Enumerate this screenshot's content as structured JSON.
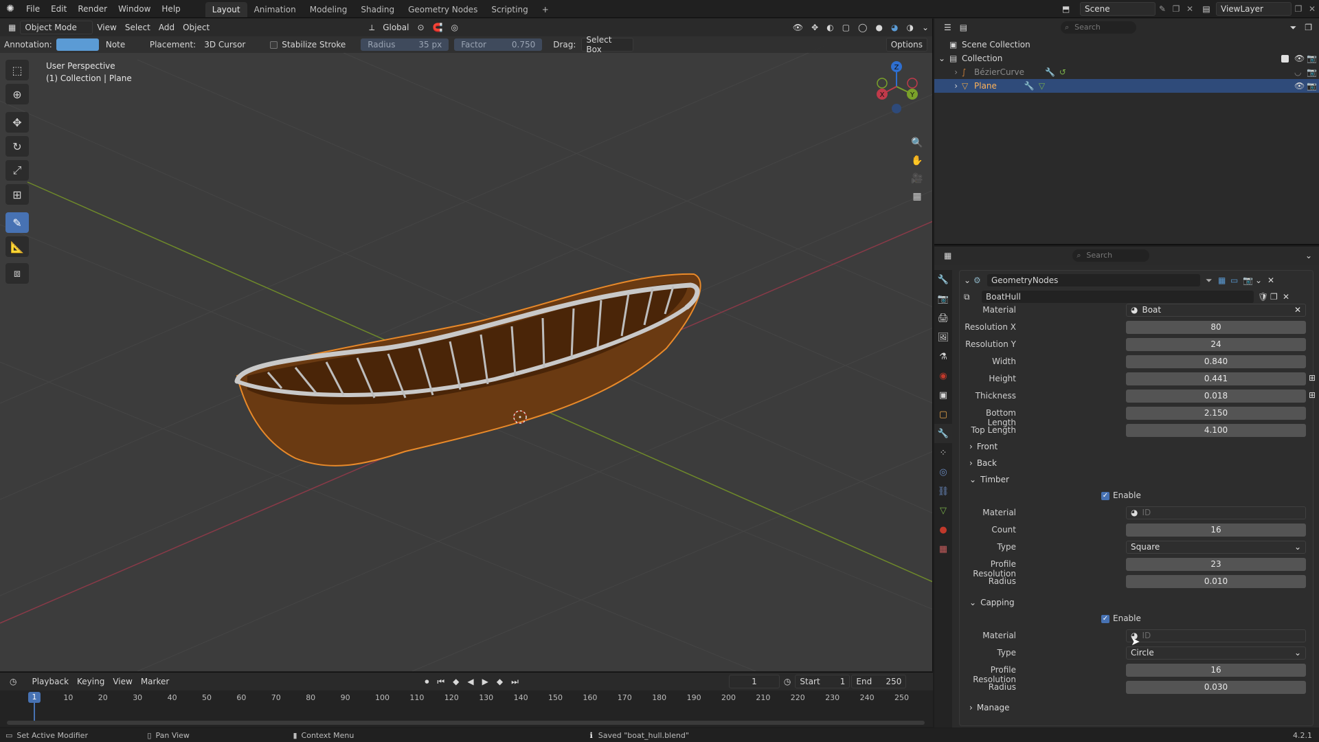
{
  "menu": {
    "items": [
      "File",
      "Edit",
      "Render",
      "Window",
      "Help"
    ]
  },
  "workspaces": {
    "tabs": [
      "Layout",
      "Animation",
      "Modeling",
      "Shading",
      "Geometry Nodes",
      "Scripting"
    ],
    "active": "Layout",
    "add": "+"
  },
  "scene": {
    "name": "Scene",
    "view_layer": "ViewLayer"
  },
  "viewport": {
    "mode": "Object Mode",
    "menus": [
      "View",
      "Select",
      "Add",
      "Object"
    ],
    "orientation": "Global",
    "overlay_text": {
      "perspective": "User Perspective",
      "collection": "(1) Collection | Plane"
    },
    "gizmo_axes": {
      "x": "X",
      "y": "Y",
      "z": "Z"
    }
  },
  "tool_settings": {
    "annotation_label": "Annotation:",
    "annotation_color": "#5b9bd5",
    "note": "Note",
    "placement_label": "Placement:",
    "placement": "3D Cursor",
    "stabilize": "Stabilize Stroke",
    "radius_label": "Radius",
    "radius_value": "35 px",
    "factor_label": "Factor",
    "factor_value": "0.750",
    "drag_label": "Drag:",
    "drag_value": "Select Box",
    "options": "Options"
  },
  "timeline": {
    "menus": [
      "Playback",
      "Keying",
      "View",
      "Marker"
    ],
    "current_frame": "1",
    "start_label": "Start",
    "start": "1",
    "end_label": "End",
    "end": "250",
    "ticks": [
      "10",
      "20",
      "30",
      "40",
      "50",
      "60",
      "70",
      "80",
      "90",
      "100",
      "110",
      "120",
      "130",
      "140",
      "150",
      "160",
      "170",
      "180",
      "190",
      "200",
      "210",
      "220",
      "230",
      "240",
      "250"
    ],
    "playhead": "1"
  },
  "statusbar": {
    "left": "Set Active Modifier",
    "middle": "Pan View",
    "context": "Context Menu",
    "message": "Saved \"boat_hull.blend\"",
    "version": "4.2.1"
  },
  "outliner": {
    "search_placeholder": "Search",
    "rows": [
      {
        "label": "Scene Collection"
      },
      {
        "label": "Collection"
      },
      {
        "label": "BézierCurve"
      },
      {
        "label": "Plane"
      }
    ]
  },
  "properties": {
    "search_placeholder": "Search",
    "modifier_name": "GeometryNodes",
    "node_group": "BoatHull",
    "fields": [
      {
        "label": "Material",
        "value": "Boat",
        "kind": "material"
      },
      {
        "label": "Resolution X",
        "value": "80"
      },
      {
        "label": "Resolution Y",
        "value": "24"
      },
      {
        "label": "Width",
        "value": "0.840"
      },
      {
        "label": "Height",
        "value": "0.441"
      },
      {
        "label": "Thickness",
        "value": "0.018"
      },
      {
        "label": "Bottom Length",
        "value": "2.150"
      },
      {
        "label": "Top Length",
        "value": "4.100"
      }
    ],
    "panels": {
      "front": "Front",
      "back": "Back",
      "timber": "Timber",
      "capping": "Capping",
      "manage": "Manage"
    },
    "timber": {
      "enable": "Enable",
      "material_label": "Material",
      "material_placeholder": "ID",
      "count_label": "Count",
      "count": "16",
      "type_label": "Type",
      "type": "Square",
      "profile_label": "Profile Resolution",
      "profile": "23",
      "radius_label": "Radius",
      "radius": "0.010"
    },
    "capping": {
      "enable": "Enable",
      "material_label": "Material",
      "material_placeholder": "ID",
      "type_label": "Type",
      "type": "Circle",
      "profile_label": "Profile Resolution",
      "profile": "16",
      "radius_label": "Radius",
      "radius": "0.030"
    }
  }
}
